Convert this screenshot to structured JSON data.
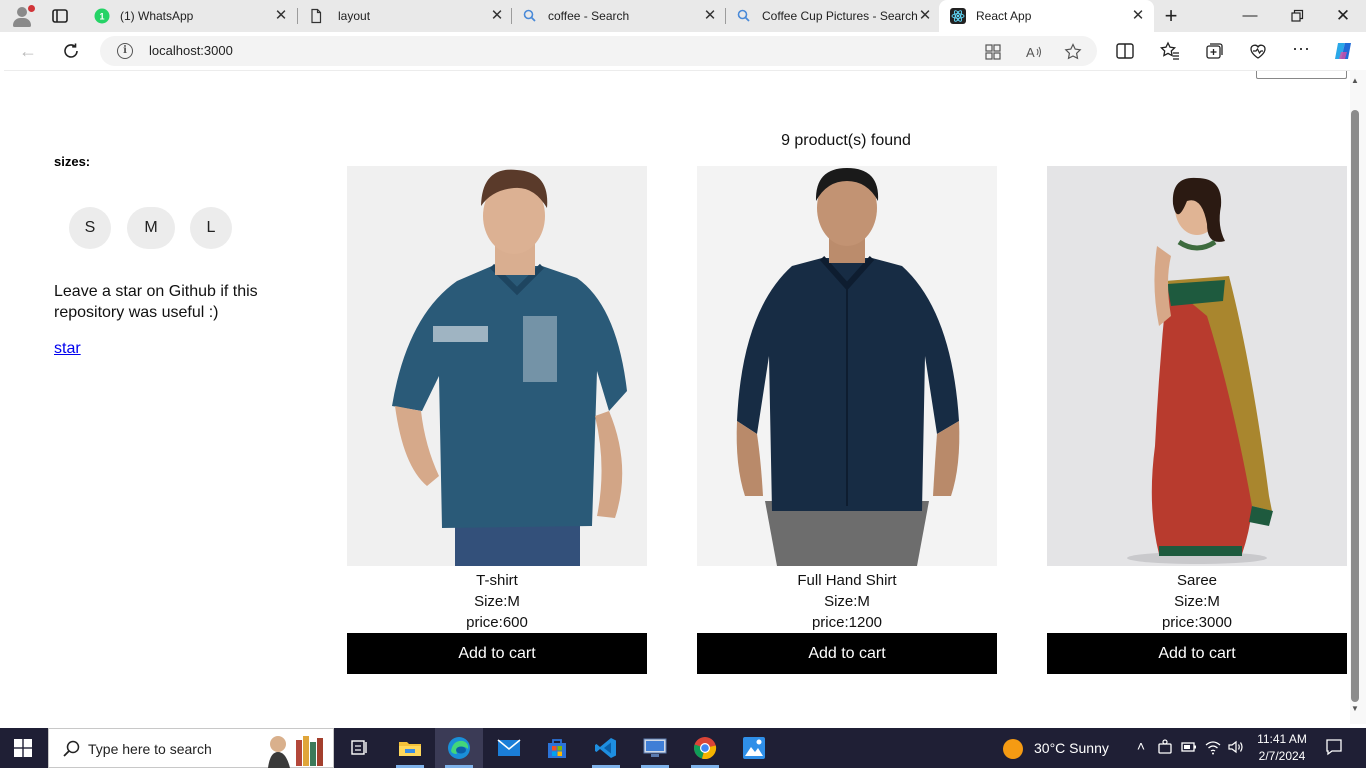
{
  "browser": {
    "tabs": [
      {
        "label": "(1) WhatsApp",
        "icon": "whatsapp-icon"
      },
      {
        "label": "layout",
        "icon": "page-icon"
      },
      {
        "label": "coffee - Search",
        "icon": "search-icon"
      },
      {
        "label": "Coffee Cup Pictures - Search",
        "icon": "search-icon"
      },
      {
        "label": "React App",
        "icon": "react-icon"
      }
    ],
    "url": "localhost:3000"
  },
  "sidebar": {
    "sizes_title": "sizes:",
    "sizes": [
      "S",
      "M",
      "L"
    ],
    "star_note": "Leave a star on Github if this repository was useful :)",
    "star_link": "star"
  },
  "products": {
    "found_text": "9 product(s) found",
    "items": [
      {
        "name": "T-shirt",
        "size": "Size:M",
        "price": "price:600",
        "button": "Add to cart"
      },
      {
        "name": "Full Hand Shirt",
        "size": "Size:M",
        "price": "price:1200",
        "button": "Add to cart"
      },
      {
        "name": "Saree",
        "size": "Size:M",
        "price": "price:3000",
        "button": "Add to cart"
      }
    ]
  },
  "taskbar": {
    "search_placeholder": "Type here to search",
    "weather": "30°C  Sunny",
    "time": "11:41 AM",
    "date": "2/7/2024"
  },
  "colors": {
    "accent": "#1f1f35",
    "cart_button": "#000000",
    "link": "#0000ee"
  }
}
